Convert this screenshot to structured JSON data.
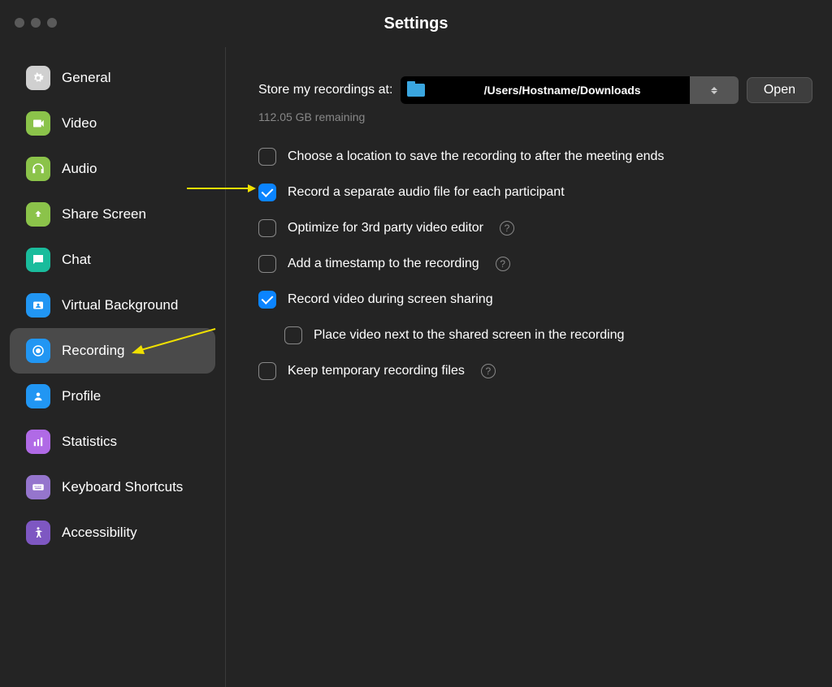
{
  "title": "Settings",
  "sidebar": {
    "items": [
      {
        "label": "General"
      },
      {
        "label": "Video"
      },
      {
        "label": "Audio"
      },
      {
        "label": "Share Screen"
      },
      {
        "label": "Chat"
      },
      {
        "label": "Virtual Background"
      },
      {
        "label": "Recording"
      },
      {
        "label": "Profile"
      },
      {
        "label": "Statistics"
      },
      {
        "label": "Keyboard Shortcuts"
      },
      {
        "label": "Accessibility"
      }
    ]
  },
  "main": {
    "store_label": "Store my recordings at:",
    "path": "/Users/Hostname/Downloads",
    "open_label": "Open",
    "remaining": "112.05 GB remaining",
    "options": {
      "choose_location": "Choose a location to save the recording to after the meeting ends",
      "separate_audio": "Record a separate audio file for each participant",
      "optimize": "Optimize for 3rd party video editor",
      "timestamp": "Add a timestamp to the recording",
      "record_video_sharing": "Record video during screen sharing",
      "place_video_next": "Place video next to the shared screen in the recording",
      "keep_temp": "Keep temporary recording files"
    }
  }
}
